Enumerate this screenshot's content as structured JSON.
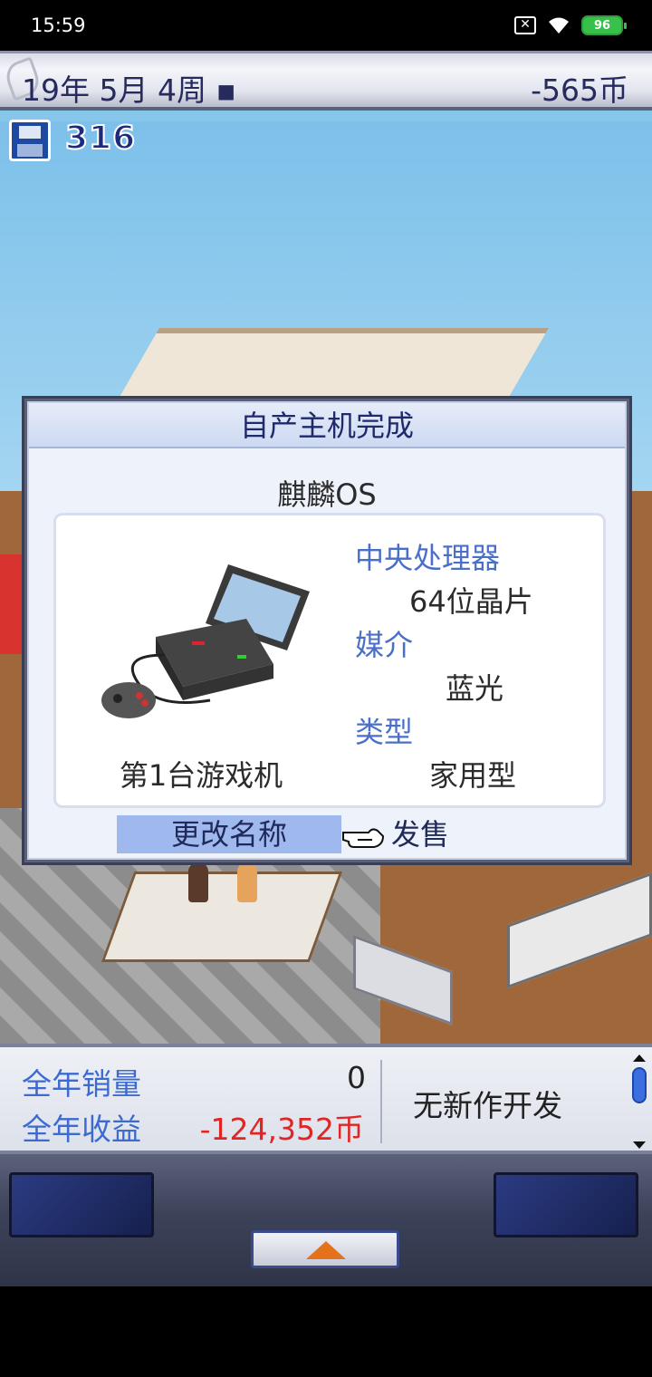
{
  "status_bar": {
    "time": "15:59",
    "battery": "96"
  },
  "top_bar": {
    "date": "19年 5月 4周 ▪",
    "money": "-565币"
  },
  "scene": {
    "save_count": "316"
  },
  "dialog": {
    "title": "自产主机完成",
    "console_name": "麒麟OS",
    "console_caption": "第1台游戏机",
    "specs": [
      {
        "label": "中央处理器",
        "value": "64位晶片"
      },
      {
        "label": "媒介",
        "value": "蓝光"
      },
      {
        "label": "类型",
        "value": "家用型"
      }
    ],
    "rename_button": "更改名称",
    "sell_button": "发售"
  },
  "stats": {
    "annual_sales_label": "全年销量",
    "annual_sales_value": "0",
    "annual_revenue_label": "全年收益",
    "annual_revenue_value": "-124,352币",
    "dev_status": "无新作开发"
  },
  "colors": {
    "accent_blue": "#3d6ad0",
    "negative_red": "#e02525",
    "title_navy": "#1e2a6b"
  }
}
